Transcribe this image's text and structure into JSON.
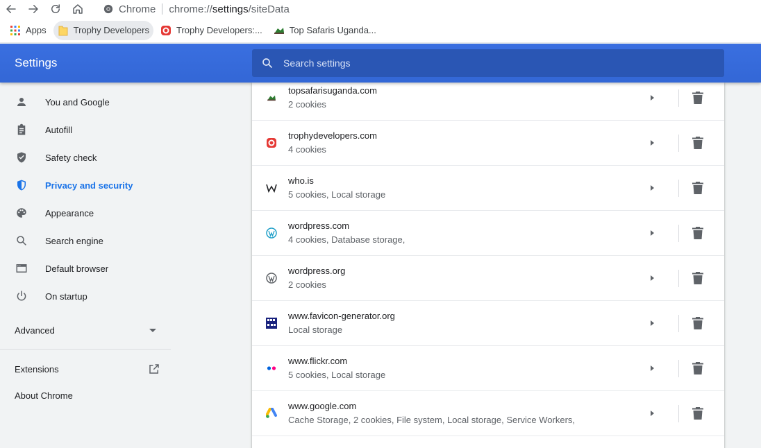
{
  "browser": {
    "omnibox_brand": "Chrome",
    "url_prefix": "chrome://",
    "url_host": "settings",
    "url_path": "/siteData"
  },
  "bookmarks": [
    {
      "label": "Apps",
      "icon": "apps-grid-icon"
    },
    {
      "label": "Trophy Developers",
      "icon": "folder-icon"
    },
    {
      "label": "Trophy Developers:...",
      "icon": "trophy-developers-favicon"
    },
    {
      "label": "Top Safaris Uganda...",
      "icon": "top-safaris-favicon"
    }
  ],
  "header": {
    "title": "Settings",
    "search_placeholder": "Search settings"
  },
  "sidebar": {
    "items": [
      {
        "label": "You and Google",
        "icon": "person-icon"
      },
      {
        "label": "Autofill",
        "icon": "clipboard-icon"
      },
      {
        "label": "Safety check",
        "icon": "shield-check-icon"
      },
      {
        "label": "Privacy and security",
        "icon": "shield-icon",
        "active": true
      },
      {
        "label": "Appearance",
        "icon": "palette-icon"
      },
      {
        "label": "Search engine",
        "icon": "search-icon"
      },
      {
        "label": "Default browser",
        "icon": "browser-icon"
      },
      {
        "label": "On startup",
        "icon": "power-icon"
      }
    ],
    "advanced_label": "Advanced",
    "extensions_label": "Extensions",
    "about_label": "About Chrome"
  },
  "sites": [
    {
      "name": "topsafarisuganda.com",
      "data": "2 cookies",
      "favicon": "top-safaris-favicon"
    },
    {
      "name": "trophydevelopers.com",
      "data": "4 cookies",
      "favicon": "trophy-developers-favicon"
    },
    {
      "name": "who.is",
      "data": "5 cookies, Local storage",
      "favicon": "whois-favicon"
    },
    {
      "name": "wordpress.com",
      "data": "4 cookies, Database storage,",
      "favicon": "wordpress-com-favicon"
    },
    {
      "name": "wordpress.org",
      "data": "2 cookies",
      "favicon": "wordpress-org-favicon"
    },
    {
      "name": "www.favicon-generator.org",
      "data": "Local storage",
      "favicon": "favicon-generator-favicon"
    },
    {
      "name": "www.flickr.com",
      "data": "5 cookies, Local storage",
      "favicon": "flickr-favicon"
    },
    {
      "name": "www.google.com",
      "data": "Cache Storage, 2 cookies, File system, Local storage, Service Workers,",
      "favicon": "google-ads-favicon"
    }
  ],
  "colors": {
    "header_blue": "#3367d6",
    "active_blue": "#1a73e8"
  }
}
